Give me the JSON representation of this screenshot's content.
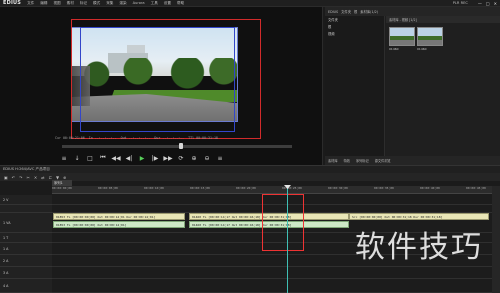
{
  "menubar": {
    "logo": "EDIUS",
    "items": [
      "文件",
      "编辑",
      "视图",
      "素材",
      "标记",
      "模式",
      "采集",
      "渲染",
      "Aurora",
      "工具",
      "设置",
      "帮助"
    ],
    "plr_label": "PLR REC",
    "window_buttons": [
      "—",
      "□",
      "✕"
    ]
  },
  "player": {
    "timecodes": [
      "Cur 00:00:21:06",
      "In --:--:--:--",
      "Out --:--:--:--",
      "Dur --:--:--:--",
      "TTl 00:00:31:18"
    ],
    "controls": [
      "≡",
      "↓",
      "□",
      "⏮",
      "◀◀",
      "◀|",
      "▶",
      "|▶",
      "▶▶",
      "⟳",
      "⊕",
      "⊖",
      "≡"
    ]
  },
  "bin": {
    "top_labels": [
      "EDIUS",
      "文件夹",
      "根",
      "素材库(1/2)"
    ],
    "tree": [
      "文件夹",
      "根",
      "视频"
    ],
    "clip_header": "素材库 - 视频 [1/2]",
    "clips": [
      {
        "label": "01460"
      },
      {
        "label": "01460"
      }
    ],
    "tabs": [
      "素材库",
      "特效",
      "序列标记",
      "源文件浏览"
    ]
  },
  "timeline": {
    "title": "EDIUS  H:264/AVC 产品项目",
    "tab": "序列1",
    "ruler_ticks": [
      "00:00:00;00",
      "00:00:05;00",
      "00:00:10;00",
      "00:00:15;00",
      "00:00:20;00",
      "00:00:25;00",
      "00:00:30;00",
      "00:00:35;00",
      "00:00:40;00",
      "00:00:45;00"
    ],
    "tracks": [
      "1 V",
      "2 V",
      "1 VA",
      "1 T",
      "1 A",
      "2 A",
      "3 A",
      "4 A"
    ],
    "clips": {
      "v1_a": "01853  TL [00:00:00;00] Out 00:00:14;01 Dur 00:00:14;01]",
      "v1_b": "01460  TL [00:00:14;17 Out 00:00:46;18] Dur 00:00:31;18]",
      "v1_c": "Src [00:00:00;00] Out 00:00:31;18 Dur 00:00:31;18]",
      "a1_a": "01853  TL [00:00:00;00] Out 00:00:14;01]",
      "a1_b": "01460  TL [00:00:14;17 Out 00:00:46;18] Dur 00:00:31;18]"
    }
  },
  "watermark": "软件技巧"
}
